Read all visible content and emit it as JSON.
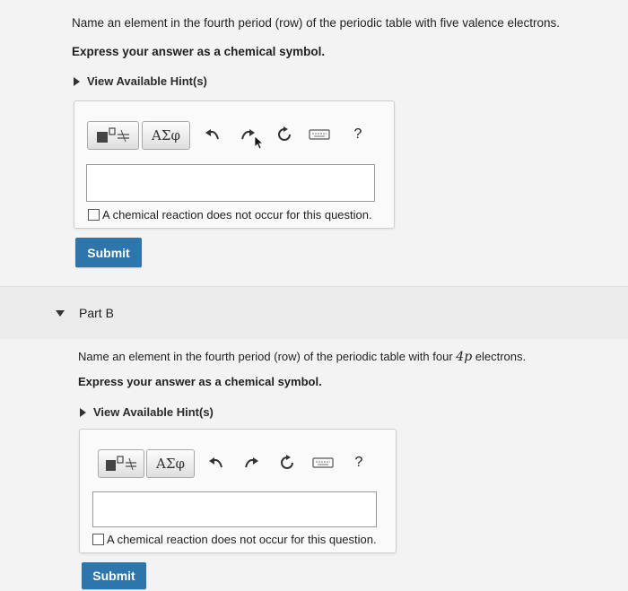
{
  "part_a": {
    "question": "Name an element in the fourth period (row) of the periodic table with five valence electrons.",
    "instruction": "Express your answer as a chemical symbol.",
    "hint_label": "View Available Hint(s)",
    "toolbar": {
      "greek_label": "ΑΣφ",
      "help_label": "?"
    },
    "answer_value": "",
    "no_reaction_label": "A chemical reaction does not occur for this question.",
    "submit_label": "Submit"
  },
  "part_b": {
    "header": "Part B",
    "question_prefix": "Name an element in the fourth period (row) of the periodic table with four ",
    "question_orbital": "4p",
    "question_suffix": " electrons.",
    "instruction": "Express your answer as a chemical symbol.",
    "hint_label": "View Available Hint(s)",
    "toolbar": {
      "greek_label": "ΑΣφ",
      "help_label": "?"
    },
    "answer_value": "",
    "no_reaction_label": "A chemical reaction does not occur for this question.",
    "submit_label": "Submit"
  },
  "colors": {
    "submit": "#2d76ad",
    "background": "#f3f3f3"
  }
}
